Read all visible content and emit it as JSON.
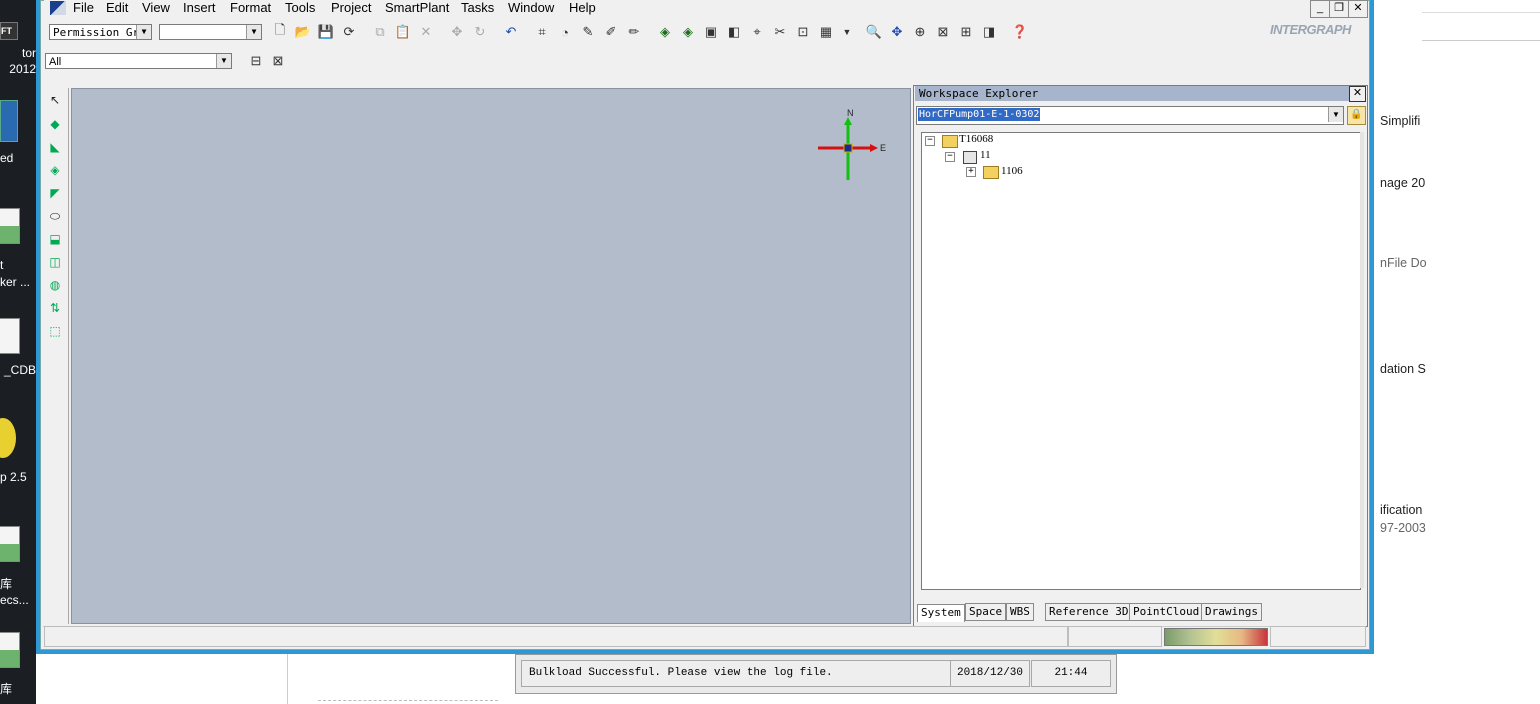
{
  "desktop": {
    "labels": [
      "tor",
      "2012",
      "ed",
      "t",
      "ker ...",
      "_CDB",
      "p 2.5",
      "库",
      "ecs...",
      "库"
    ],
    "ft_badge": "FT"
  },
  "background_doc": {
    "lines": [
      "Simplifi",
      "nage 20",
      "nFile Do",
      "dation S",
      "ification",
      "97-2003"
    ]
  },
  "menu": {
    "items": [
      "File",
      "Edit",
      "View",
      "Insert",
      "Format",
      "Tools",
      "Project",
      "SmartPlant",
      "Tasks",
      "Window",
      "Help"
    ]
  },
  "window_controls": {
    "minimize": "_",
    "restore": "❐",
    "close": "✕"
  },
  "toolbar": {
    "permission_group": "Permission Gro",
    "second_combo": "",
    "filter_combo": "All"
  },
  "brand": "INTERGRAPH",
  "compass": {
    "north": "N",
    "east": "E"
  },
  "workspace_explorer": {
    "title": "Workspace Explorer",
    "filter_value": "HorCFPump01-E-1-0302",
    "tree": [
      {
        "label": "T16068",
        "expanded": true
      },
      {
        "label": "11",
        "expanded": true
      },
      {
        "label": "1106",
        "expanded": false
      }
    ],
    "tabs": [
      "System",
      "Space",
      "WBS",
      "Reference 3D",
      "PointCloud",
      "Drawings"
    ],
    "active_tab": "System"
  },
  "bulkload": {
    "message": "Bulkload Successful. Please view the log file.",
    "date": "2018/12/30",
    "time": "21:44"
  },
  "colors": {
    "window_frame": "#2e98d4",
    "graphic_bg": "#b3bccb",
    "panel_title": "#a6b4cc",
    "selection": "#316ac5"
  }
}
